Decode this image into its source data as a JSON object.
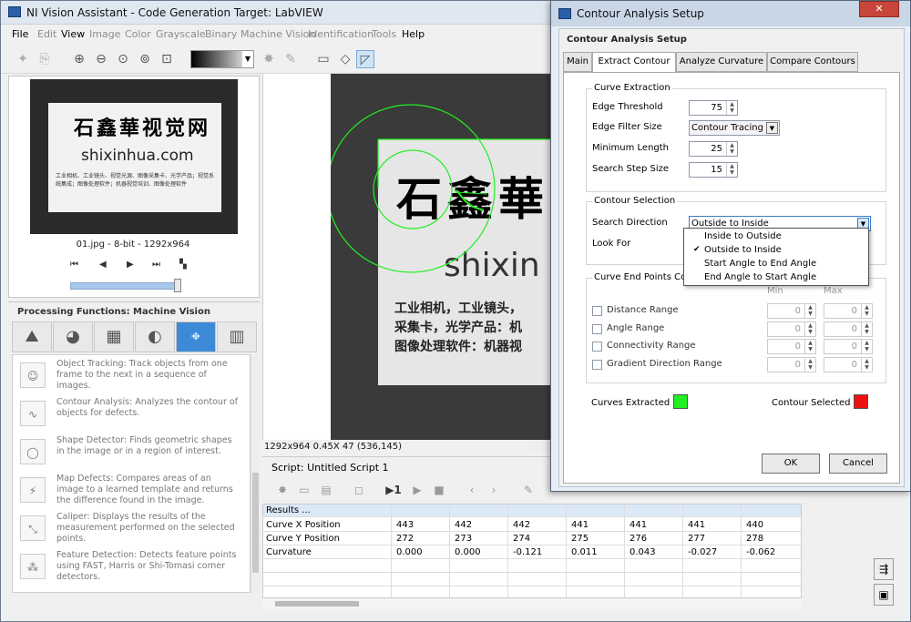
{
  "window": {
    "title": "NI Vision Assistant - Code Generation Target: LabVIEW"
  },
  "menu": [
    "File",
    "Edit",
    "View",
    "Image",
    "Color",
    "Grayscale",
    "Binary",
    "Machine Vision",
    "Identification",
    "Tools",
    "Help"
  ],
  "menu_enabled": [
    true,
    false,
    true,
    false,
    false,
    false,
    false,
    false,
    false,
    false,
    true
  ],
  "thumbnail": {
    "cn_text": "石鑫華视觉网",
    "url_text": "shixinhua.com",
    "body_text": "工业相机、工业镜头、视觉光源、图像采集卡、光学产品；视觉系统集成；图像处理软件；机器视觉培训、图像处理软件",
    "caption": "01.jpg - 8-bit - 1292x964"
  },
  "processing": {
    "header": "Processing Functions: Machine Vision",
    "functions": [
      {
        "icon": "object-tracking-icon",
        "text": "Object Tracking:  Track objects from one frame to the next in a sequence of images."
      },
      {
        "icon": "contour-analysis-icon",
        "text": "Contour Analysis:  Analyzes the contour of objects for defects."
      },
      {
        "icon": "shape-detector-icon",
        "text": "Shape Detector:  Finds geometric shapes in the image or in a region of interest."
      },
      {
        "icon": "map-defects-icon",
        "text": "Map Defects:  Compares areas of an image to a learned template and returns the difference found in the image."
      },
      {
        "icon": "caliper-icon",
        "text": "Caliper:  Displays the results of the measurement performed on the selected points."
      },
      {
        "icon": "feature-detection-icon",
        "text": "Feature Detection:  Detects feature points using FAST, Harris or Shi-Tomasi corner detectors."
      }
    ]
  },
  "image_view": {
    "cn_text": "石鑫華",
    "url_text": "shixin",
    "body_lines": [
      "工业相机，工业镜头，",
      "采集卡，光学产品：机",
      "图像处理软件：机器视"
    ],
    "status": "1292x964 0.45X 47    (536,145)"
  },
  "script": {
    "title": "Script: Untitled Script 1"
  },
  "results": {
    "header": "Results ...",
    "rows": [
      {
        "label": "Curve X Position",
        "values": [
          "443",
          "442",
          "442",
          "441",
          "441",
          "441",
          "440"
        ]
      },
      {
        "label": "Curve Y Position",
        "values": [
          "272",
          "273",
          "274",
          "275",
          "276",
          "277",
          "278"
        ]
      },
      {
        "label": "Curvature",
        "values": [
          "0.000",
          "0.000",
          "-0.121",
          "0.011",
          "0.043",
          "-0.027",
          "-0.062"
        ]
      }
    ]
  },
  "dialog": {
    "title": "Contour Analysis Setup",
    "subtitle": "Contour Analysis Setup",
    "close_label": "✕",
    "tabs": [
      "Main",
      "Extract Contour",
      "Analyze Curvature",
      "Compare Contours"
    ],
    "active_tab": 1,
    "curve_extraction": {
      "title": "Curve Extraction",
      "edge_threshold_label": "Edge Threshold",
      "edge_threshold": "75",
      "edge_filter_label": "Edge Filter Size",
      "edge_filter": "Contour Tracing",
      "min_length_label": "Minimum Length",
      "min_length": "25",
      "search_step_label": "Search Step Size",
      "search_step": "15"
    },
    "contour_selection": {
      "title": "Contour Selection",
      "search_direction_label": "Search Direction",
      "search_direction": "Outside to Inside",
      "look_for_label": "Look For",
      "options": [
        "Inside to Outside",
        "Outside to Inside",
        "Start Angle to End Angle",
        "End Angle to Start Angle"
      ],
      "selected_option": 1
    },
    "end_points": {
      "title": "Curve End Points Constr",
      "min_label": "Min",
      "max_label": "Max",
      "rows": [
        {
          "label": "Distance Range",
          "min": "0",
          "max": "0"
        },
        {
          "label": "Angle Range",
          "min": "0",
          "max": "0"
        },
        {
          "label": "Connectivity Range",
          "min": "0",
          "max": "0"
        },
        {
          "label": "Gradient Direction Range",
          "min": "0",
          "max": "0"
        }
      ]
    },
    "curves_extracted_label": "Curves Extracted",
    "curves_extracted_color": "#22ee22",
    "contour_selected_label": "Contour Selected",
    "contour_selected_color": "#ee1111",
    "ok_label": "OK",
    "cancel_label": "Cancel"
  }
}
